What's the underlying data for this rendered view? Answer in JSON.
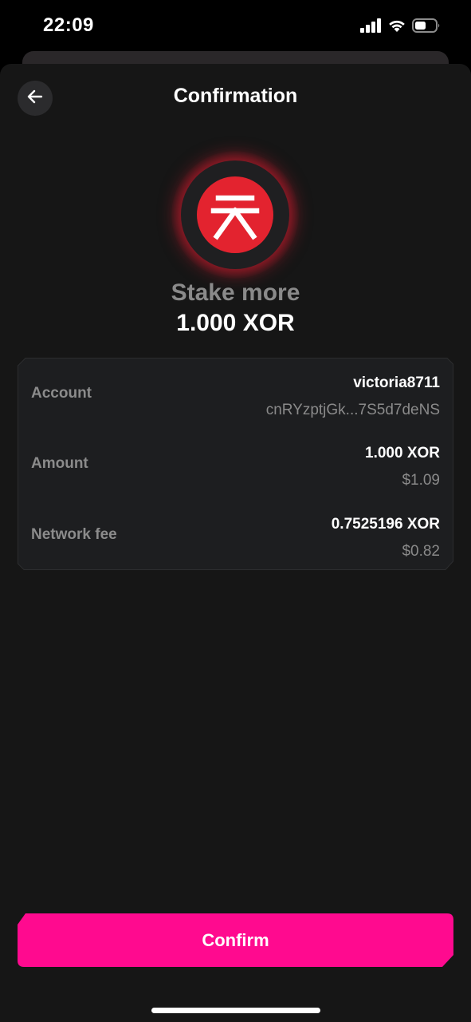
{
  "status_bar": {
    "time": "22:09",
    "icons": [
      "signal-icon",
      "wifi-icon",
      "battery-icon"
    ]
  },
  "header": {
    "title": "Confirmation",
    "back_icon": "arrow-left-icon"
  },
  "token": {
    "icon": "xor-token-icon",
    "brand_color": "#e3232f"
  },
  "operation": {
    "label": "Stake more",
    "amount": "1.000 XOR"
  },
  "details": {
    "account": {
      "label": "Account",
      "name": "victoria8711",
      "address": "cnRYzptjGk...7S5d7deNS"
    },
    "amount": {
      "label": "Amount",
      "value": "1.000 XOR",
      "fiat": "$1.09"
    },
    "network_fee": {
      "label": "Network fee",
      "value": "0.7525196 XOR",
      "fiat": "$0.82"
    }
  },
  "actions": {
    "confirm_label": "Confirm",
    "accent_color": "#ff0a8f"
  }
}
